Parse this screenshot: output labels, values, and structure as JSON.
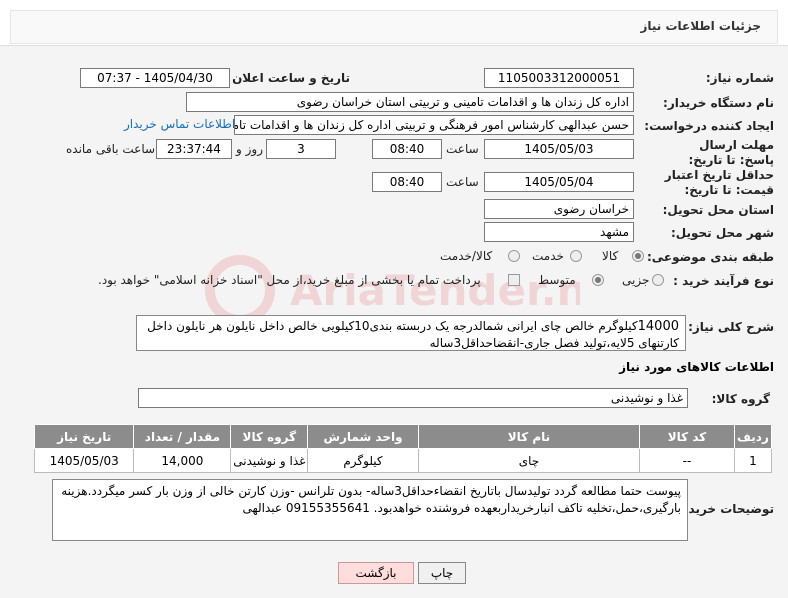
{
  "header": {
    "title": "جزئیات اطلاعات نیاز"
  },
  "form": {
    "need_number_label": "شماره نیاز:",
    "need_number": "1105003312000051",
    "announce_label": "تاریخ و ساعت اعلان عمومی:",
    "announce_value": "1405/04/30 - 07:37",
    "buyer_org_label": "نام دستگاه خریدار:",
    "buyer_org": "اداره کل زندان ها و اقدامات تامینی و تربیتی استان خراسان رضوی",
    "requester_label": "ایجاد کننده درخواست:",
    "requester": "حسن عبدالهی کارشناس امور فرهنگی و تربیتی اداره کل زندان ها و اقدامات تامی",
    "contact_link": "اطلاعات تماس خریدار",
    "reply_deadline_label": "مهلت ارسال پاسخ: تا تاریخ:",
    "reply_date": "1405/05/03",
    "time_label": "ساعت",
    "reply_time": "08:40",
    "days_value": "3",
    "days_label": "روز و",
    "remaining_time": "23:37:44",
    "remaining_label": "ساعت باقی مانده",
    "price_validity_label": "حداقل تاریخ اعتبار قیمت: تا تاریخ:",
    "price_date": "1405/05/04",
    "price_time": "08:40",
    "province_label": "استان محل تحویل:",
    "province": "خراسان رضوی",
    "city_label": "شهر محل تحویل:",
    "city": "مشهد",
    "category_label": "طبقه بندی موضوعی:",
    "category_options": [
      "کالا",
      "خدمت",
      "کالا/خدمت"
    ],
    "purchase_type_label": "نوع فرآیند خرید :",
    "purchase_options": [
      "جزیی",
      "متوسط"
    ],
    "payment_note": "پرداخت تمام یا بخشی از مبلغ خرید،از محل \"اسناد خزانه اسلامی\" خواهد بود."
  },
  "description": {
    "label": "شرح کلی نیاز:",
    "text_bold": "14000",
    "text": "کیلوگرم خالص چای ایرانی شمالدرجه یک دربسته بندی10کیلویی خالص داخل نایلون هر نایلون داخل کارتنهای 5لایه،تولید فصل جاری-انقضاحداقل3ساله"
  },
  "goods_section": {
    "title": "اطلاعات کالاهای مورد نیاز",
    "group_label": "گروه کالا:",
    "group_value": "غذا و نوشیدنی"
  },
  "table": {
    "headers": [
      "ردیف",
      "کد کالا",
      "نام کالا",
      "واحد شمارش",
      "گروه کالا",
      "مقدار / تعداد",
      "تاریخ نیاز"
    ],
    "rows": [
      [
        "1",
        "--",
        "چای",
        "کیلوگرم",
        "غذا و نوشیدنی",
        "14,000",
        "1405/05/03"
      ]
    ]
  },
  "notes": {
    "label": "توضیحات خریدار:",
    "text": "پیوست حتما مطالعه گردد تولیدسال باتاریخ انقضاءحداقل3ساله- بدون تلرانس -وزن کارتن خالی از وزن بار کسر میگردد.هزینه بارگیری،حمل،تخلیه تاکف انبارخریداربعهده فروشنده خواهدبود. 09155355641 عبدالهی"
  },
  "buttons": {
    "print": "چاپ",
    "back": "بازگشت"
  },
  "watermark": {
    "text": "AriaTender.net"
  }
}
